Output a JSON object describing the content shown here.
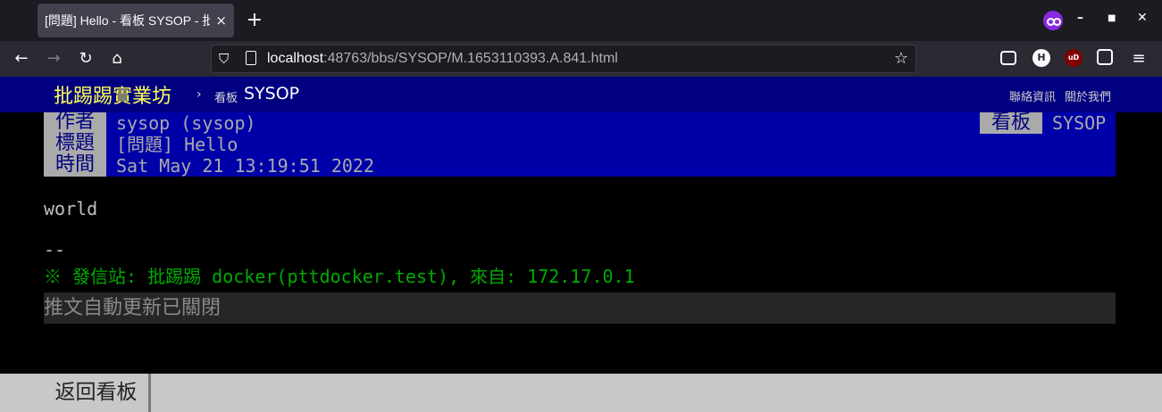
{
  "browser": {
    "tab_title": "[問題] Hello - 看板 SYSOP - 批",
    "tab_close": "×",
    "new_tab": "+",
    "url_host": "localhost",
    "url_rest": ":48763/bbs/SYSOP/M.1653110393.A.841.html",
    "window_minimize": "–",
    "window_maximize": "■",
    "window_close": "✕",
    "toolbar_icons": [
      "pocket-icon",
      "h-extension-icon",
      "ublock-icon",
      "tampermonkey-icon",
      "menu-icon"
    ],
    "h_label": "H",
    "ub_label": "uD"
  },
  "site": {
    "logo": "批踢踢實業坊",
    "crumb_sep": "›",
    "crumb_board_label": "看板",
    "crumb_board": "SYSOP",
    "links": [
      "聯絡資訊",
      "關於我們"
    ]
  },
  "article": {
    "author_label": "作者",
    "author": "sysop (sysop)",
    "title_label": "標題",
    "title": "[問題] Hello",
    "time_label": "時間",
    "time": "Sat May 21 13:19:51 2022",
    "board_label": "看板",
    "board": "SYSOP",
    "content": "world",
    "signature_sep": "--",
    "origin": "※ 發信站: 批踢踢 docker(pttdocker.test), 來自: 172.17.0.1"
  },
  "push_status": "推文自動更新已關閉",
  "back_button": "返回看板",
  "colors": {
    "header_bg": "#000080",
    "meta_bg": "#0000a8",
    "logo": "#ffff55",
    "origin_green": "#00aa00"
  }
}
